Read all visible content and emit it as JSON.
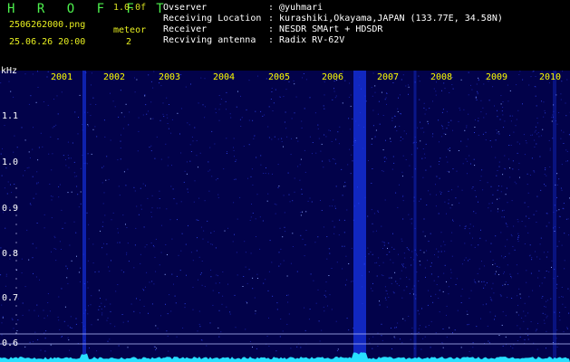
{
  "header": {
    "brand": "H R O F F T",
    "version": "1.0.0f",
    "filename": "2506262000.png",
    "mode": "meteor",
    "datetime": "25.06.26 20:00",
    "count": "2",
    "info": [
      {
        "key": "Ovserver",
        "value": ": @yuhmari"
      },
      {
        "key": "Receiving Location",
        "value": ": kurashiki,Okayama,JAPAN (133.77E, 34.58N)"
      },
      {
        "key": "Receiver",
        "value": ": NESDR SMArt + HDSDR"
      },
      {
        "key": "Recviving antenna",
        "value": ": Radix RV-62V"
      }
    ]
  },
  "axis": {
    "unit": "kHz",
    "y_ticks": [
      "1.1",
      "1.0",
      "0.9",
      "0.8",
      "0.7",
      "0.6"
    ],
    "x_ticks": [
      "2001",
      "2002",
      "2003",
      "2004",
      "2005",
      "2006",
      "2007",
      "2008",
      "2009",
      "2010"
    ]
  },
  "colors": {
    "background": "#000000",
    "plot_bg": "#02024a",
    "brand": "#4df04d",
    "meta": "#e8f020",
    "year_label": "#ffff00",
    "signal_band": "#1a3cff",
    "baseline": "#28e0ff"
  }
}
